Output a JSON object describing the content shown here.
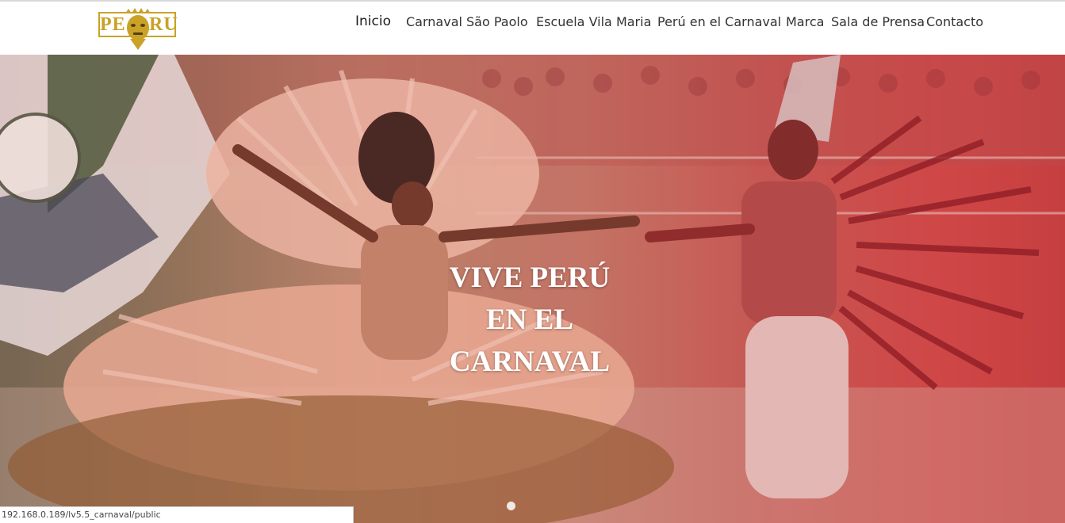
{
  "brand": {
    "logo_left": "PE",
    "logo_right": "RU",
    "logo_color": "#c9a227"
  },
  "nav": {
    "items": [
      {
        "label": "Inicio",
        "active": true
      },
      {
        "label": "Carnaval São Paolo"
      },
      {
        "label": "Escuela Vila Maria"
      },
      {
        "label": "Perú en el Carnaval"
      },
      {
        "label": "Marca"
      },
      {
        "label": "Sala de Prensa"
      },
      {
        "label": "Contacto"
      }
    ]
  },
  "hero": {
    "title_line1": "VIVE PERÚ",
    "title_line2": "EN EL",
    "title_line3": "CARNAVAL",
    "overlay_color": "#c73f40",
    "active_slide": 1
  },
  "status_bar": {
    "url": "192.168.0.189/lv5.5_carnaval/public"
  }
}
